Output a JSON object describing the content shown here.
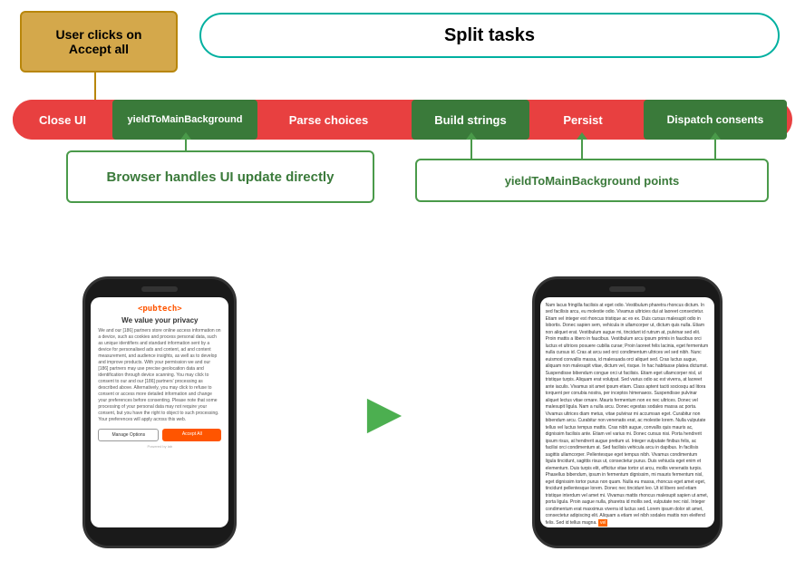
{
  "diagram": {
    "user_clicks_label": "User clicks on\nAccept all",
    "split_tasks_label": "Split tasks",
    "segments": {
      "close_ui": "Close UI",
      "yield1": "yieldToMainBackground",
      "parse_choices": "Parse choices",
      "build_strings": "Build strings",
      "persist": "Persist",
      "dispatch_consents": "Dispatch consents"
    },
    "browser_handles_label": "Browser handles UI update directly",
    "yield_points_label": "yieldToMainBackground points"
  },
  "phone1": {
    "header": "<pubtech>",
    "title": "We value your privacy",
    "body": "We and our [186] partners store online access information on a device, such as cookies and process personal data, such as unique identifiers and standard information sent by a device for personalised ads and content, ad and content measurement, and audience insights, as well as to develop and improve products. With your permission we and our [186] partners may use precise geolocation data and identification through device scanning. You may click to consent to our and our [186] partners' processing as described above. Alternatively, you may click to refuse to consent or access more detailed information and change your preferences before consenting. Please note that some processing of your personal data may not require your consent, but you have the right to object to such processing. Your preferences will apply across this web.",
    "btn_manage": "Manage Options",
    "btn_accept": "Accept All",
    "footer": "Powered by iab"
  },
  "phone2": {
    "article_text": "Nam lacus fringilla facilisis at eget odio. Vestibulum pharetra rhoncus dictum. In sed facilisis arcu, eu molestie odio. Vivamus ultricies dui at laoreet consectetur. Etiam vel integer est rhoncus tristique ac ex ex. Duis cursus malesupit odio in lobortis. Donec sapien sem, vehicula in ullamcorper ut, dictum quis nulla. Etiam non aliquet erat. Vestibulum augue mi, tincidunt id rutrum at, pulvinar sed elit. Proin mattis a libero in faucibus. Vestibulum arcu ipsum primis in faucibus orci luctus et ultrices posuere cubilia curae; Proin laoreet felis lacinia, eget fermentum nulla cursus id. Cras at arcu sed orci condimentum ultrices vel sed nibh. Nunc euismod convallis massa, id malesuada orci aliquet sed. Cras luctus augue, aliquam non malesupit vitae, dictum vel, risque. In hac habitasse platea dictumst. Suspendisse bibendum congue orci ut facilisis. Etiam eget ullamcorper nisl, ut tristique turpis. Aliquam erat volutpat. Sed varius odio ac est viverra, at laoreet ante iaculis. Vivamus sit amet ipsum etiam. Class aptent taciti sociosqu ad litora torquent per conubia nostra, per inceptos himenaeos. Suspendisse pulvinar aliquet lectus vitae ornare. Mauris fermentum non ex nec ultrices. Donec vel malesupit ligula. Nam a nulla arcu. Donec egestas sodales massa ac porta. Vivamus ultrices diam metus, vitae pulvinar mi accumsan eget. Curabitur non bibendum arcu. Curabitur non venenatis erat, ac molestie lorem. Nulla vulputate tellus vel luctus tempus mattis. Cras nibh augue, convallis quis mauris ac, dignissim facilisis ante. Etiam vel varius mi. Donec cursus nisi. Porta hendrerit ipsum risus, at hendrerit augue pretium ut. Integer vulputate finibus felis, ac facilisi orci condimentum at. Sed facilisis vehicula arcu in dapibus. In facilisis sagittis ullamcorper. Pellentesque eget tempus nibh. Vivamus condimentum ligula tincidunt, sagittis risus ut, consectetur purus. Duis vehiucla eget enim et elementum. Duis turpis elit, efficitur vitae tortor ut arcu, mollis venenatis turpis. Phasellus bibendum, ipsum in fermentum dignissim, mi mauris fermentum nisl, eget dignissim tortor purus non quam. Nulla eu massa, rhoncus eget amet eget, tincidunt pellentesque lorem. Donec nec tincidunt leo. Ut id libero sed etiam tristique interdum vel amet mi. Vivamus mattis rhoncus malesupit sapien ut amet, porta ligula. Proin augue nulla, pharetra id mollis sed, vulputate nec nisl. Integer condimentum erat maxximus viverra id luctus sed. Lorem ipsum dolor sit amet, consectetur adipiscing elit. Aliquam a etiam vel nibh sodales mattis non eleifend felis. Sed id tellus magna."
  },
  "colors": {
    "orange_box": "#d4a84b",
    "teal_oval": "#00b0a0",
    "red_pipeline": "#e84040",
    "green_segment": "#3a7a3a",
    "green_arrow": "#4a9a4a",
    "green_arrow_big": "#4caf50"
  }
}
